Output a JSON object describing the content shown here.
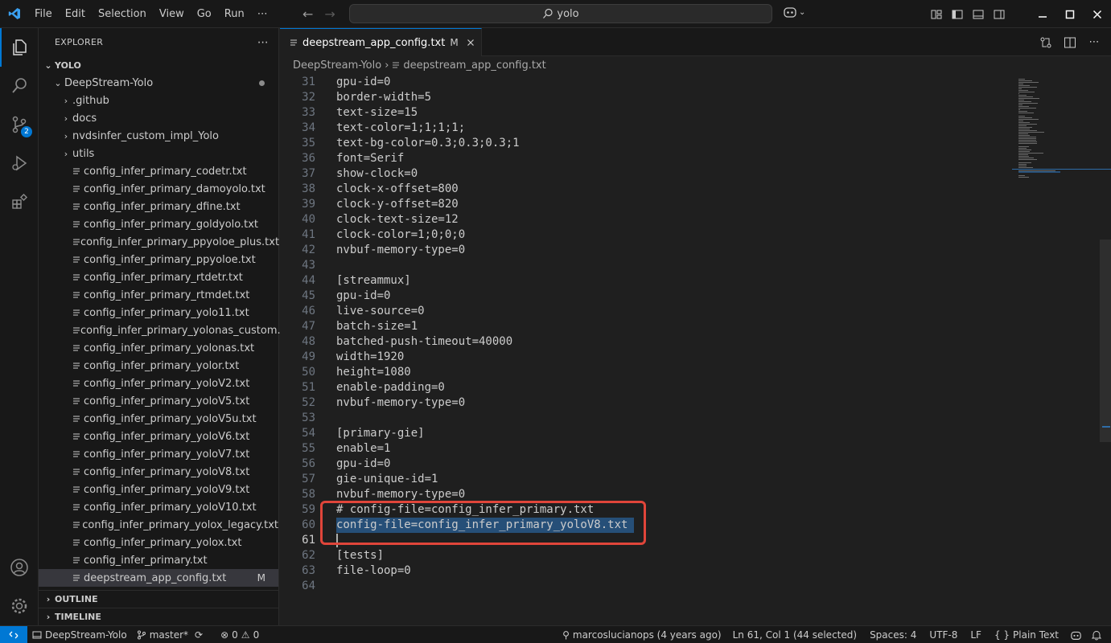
{
  "menu": [
    "File",
    "Edit",
    "Selection",
    "View",
    "Go",
    "Run",
    "⋯"
  ],
  "search": {
    "text": "yolo"
  },
  "sidebar": {
    "title": "EXPLORER",
    "more": "⋯",
    "root": "YOLO",
    "folder": "DeepStream-Yolo",
    "subfolders": [
      ".github",
      "docs",
      "nvdsinfer_custom_impl_Yolo",
      "utils"
    ],
    "files": [
      "config_infer_primary_codetr.txt",
      "config_infer_primary_damoyolo.txt",
      "config_infer_primary_dfine.txt",
      "config_infer_primary_goldyolo.txt",
      "config_infer_primary_ppyoloe_plus.txt",
      "config_infer_primary_ppyoloe.txt",
      "config_infer_primary_rtdetr.txt",
      "config_infer_primary_rtmdet.txt",
      "config_infer_primary_yolo11.txt",
      "config_infer_primary_yolonas_custom.txt",
      "config_infer_primary_yolonas.txt",
      "config_infer_primary_yolor.txt",
      "config_infer_primary_yoloV2.txt",
      "config_infer_primary_yoloV5.txt",
      "config_infer_primary_yoloV5u.txt",
      "config_infer_primary_yoloV6.txt",
      "config_infer_primary_yoloV7.txt",
      "config_infer_primary_yoloV8.txt",
      "config_infer_primary_yoloV9.txt",
      "config_infer_primary_yoloV10.txt",
      "config_infer_primary_yolox_legacy.txt",
      "config_infer_primary_yolox.txt",
      "config_infer_primary.txt"
    ],
    "selected_file": "deepstream_app_config.txt",
    "selected_status": "M",
    "outline": "OUTLINE",
    "timeline": "TIMELINE"
  },
  "activity": {
    "scm_badge": "2"
  },
  "editor": {
    "tab_label": "deepstream_app_config.txt",
    "tab_status": "M",
    "breadcrumb": [
      "DeepStream-Yolo",
      "deepstream_app_config.txt"
    ],
    "lines": [
      {
        "n": "31",
        "t": "gpu-id=0"
      },
      {
        "n": "32",
        "t": "border-width=5"
      },
      {
        "n": "33",
        "t": "text-size=15"
      },
      {
        "n": "34",
        "t": "text-color=1;1;1;1;"
      },
      {
        "n": "35",
        "t": "text-bg-color=0.3;0.3;0.3;1"
      },
      {
        "n": "36",
        "t": "font=Serif"
      },
      {
        "n": "37",
        "t": "show-clock=0"
      },
      {
        "n": "38",
        "t": "clock-x-offset=800"
      },
      {
        "n": "39",
        "t": "clock-y-offset=820"
      },
      {
        "n": "40",
        "t": "clock-text-size=12"
      },
      {
        "n": "41",
        "t": "clock-color=1;0;0;0"
      },
      {
        "n": "42",
        "t": "nvbuf-memory-type=0"
      },
      {
        "n": "43",
        "t": ""
      },
      {
        "n": "44",
        "t": "[streammux]"
      },
      {
        "n": "45",
        "t": "gpu-id=0"
      },
      {
        "n": "46",
        "t": "live-source=0"
      },
      {
        "n": "47",
        "t": "batch-size=1"
      },
      {
        "n": "48",
        "t": "batched-push-timeout=40000"
      },
      {
        "n": "49",
        "t": "width=1920"
      },
      {
        "n": "50",
        "t": "height=1080"
      },
      {
        "n": "51",
        "t": "enable-padding=0"
      },
      {
        "n": "52",
        "t": "nvbuf-memory-type=0"
      },
      {
        "n": "53",
        "t": ""
      },
      {
        "n": "54",
        "t": "[primary-gie]"
      },
      {
        "n": "55",
        "t": "enable=1"
      },
      {
        "n": "56",
        "t": "gpu-id=0"
      },
      {
        "n": "57",
        "t": "gie-unique-id=1"
      },
      {
        "n": "58",
        "t": "nvbuf-memory-type=0"
      },
      {
        "n": "59",
        "t": "# config-file=config_infer_primary.txt"
      },
      {
        "n": "60",
        "t": "config-file=config_infer_primary_yoloV8.txt",
        "selected": true
      },
      {
        "n": "61",
        "t": "",
        "cursor": true
      },
      {
        "n": "62",
        "t": "[tests]"
      },
      {
        "n": "63",
        "t": "file-loop=0"
      },
      {
        "n": "64",
        "t": ""
      }
    ]
  },
  "statusbar": {
    "folder": "DeepStream-Yolo",
    "branch": "master*",
    "errors": "0",
    "warnings": "0",
    "blame": "marcoslucianops (4 years ago)",
    "position": "Ln 61, Col 1 (44 selected)",
    "spaces": "Spaces: 4",
    "encoding": "UTF-8",
    "eol": "LF",
    "language": "Plain Text"
  },
  "colors": {
    "accent": "#0078d4",
    "highlight_box": "#e0453a",
    "selection": "#264f78"
  }
}
